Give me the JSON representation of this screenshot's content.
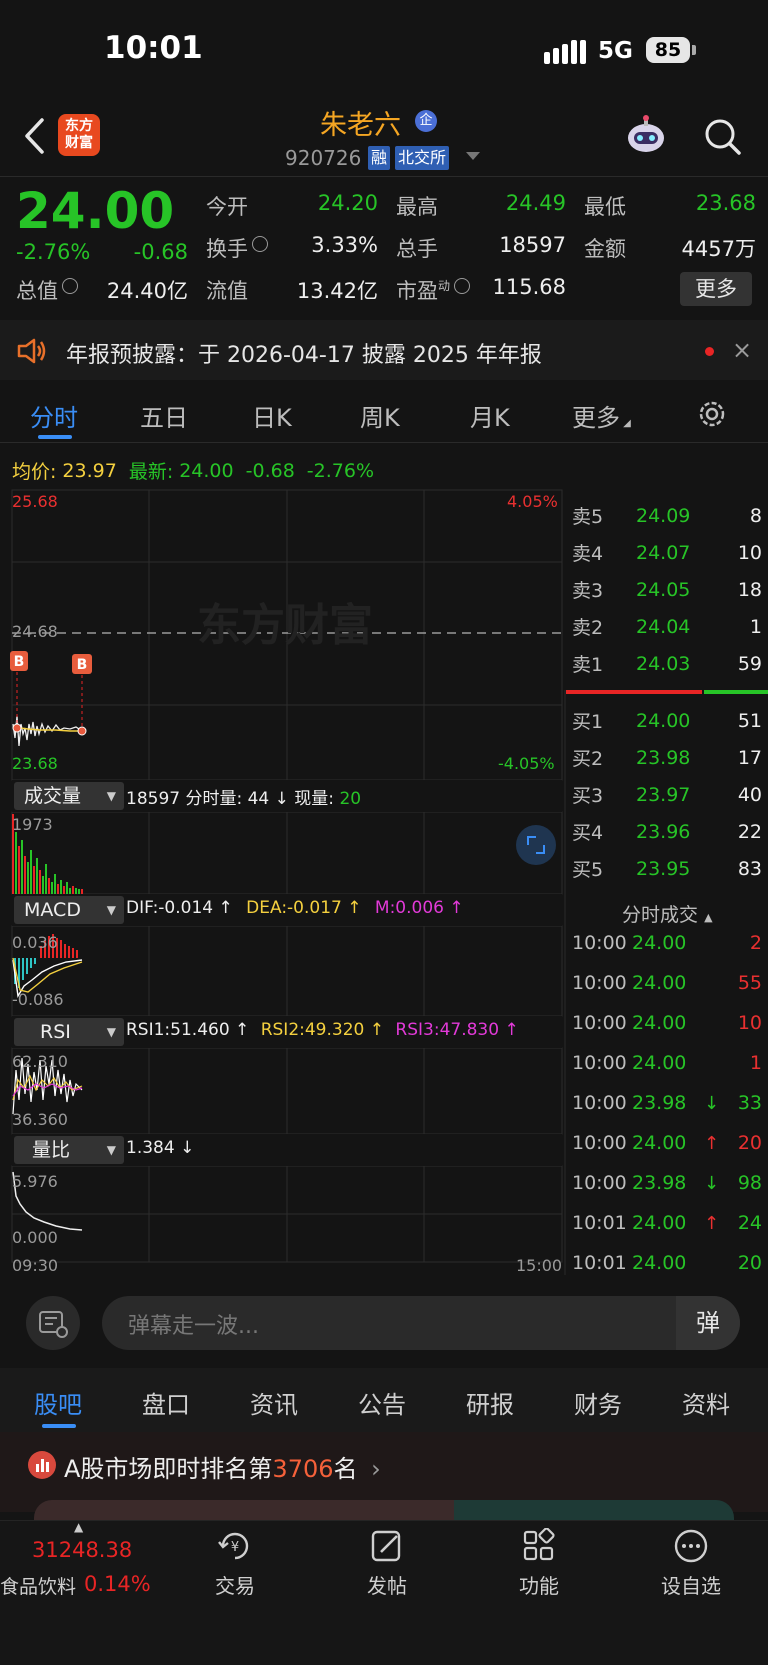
{
  "status": {
    "time": "10:01",
    "network": "5G",
    "battery": "85"
  },
  "header": {
    "logo_line1": "东方",
    "logo_line2": "财富",
    "stock_name": "朱老六",
    "enterprise_badge": "企",
    "stock_code": "920726",
    "tag_margin": "融",
    "tag_exchange": "北交所"
  },
  "quote": {
    "price": "24.00",
    "change_pct": "-2.76%",
    "change": "-0.68",
    "stats": [
      {
        "label": "今开",
        "value": "24.20",
        "color": "green"
      },
      {
        "label": "最高",
        "value": "24.49",
        "color": "green"
      },
      {
        "label": "最低",
        "value": "23.68",
        "color": "green"
      },
      {
        "label": "换手",
        "value": "3.33%",
        "color": "white"
      },
      {
        "label": "总手",
        "value": "18597",
        "color": "white"
      },
      {
        "label": "金额",
        "value": "4457万",
        "color": "white"
      },
      {
        "label": "总值",
        "value": "24.40亿",
        "color": "white"
      },
      {
        "label": "流值",
        "value": "13.42亿",
        "color": "white"
      },
      {
        "label": "市盈",
        "label_sup": "动",
        "value": "115.68",
        "color": "white"
      }
    ],
    "more_label": "更多"
  },
  "notice": {
    "text": "年报预披露：于 2026-04-17 披露 2025 年年报",
    "close": "×"
  },
  "chart_tabs": [
    "分时",
    "五日",
    "日K",
    "周K",
    "月K",
    "更多"
  ],
  "info_line": {
    "avg_label": "均价:",
    "avg_value": "23.97",
    "latest_label": "最新:",
    "latest_value": "24.00",
    "change": "-0.68",
    "pct": "-2.76%"
  },
  "price_axis": {
    "high": "25.68",
    "mid": "24.68",
    "low": "23.68",
    "high_pct": "4.05%",
    "low_pct": "-4.05%"
  },
  "watermark": "东方财富",
  "markers": [
    "B",
    "B"
  ],
  "volume_panel": {
    "selector": "成交量",
    "info": "18597 分时量: 44 ↓ 现量:",
    "now_volume": "20",
    "max": "1973"
  },
  "macd_panel": {
    "selector": "MACD",
    "dif": "DIF:-0.014 ↑",
    "dea": "DEA:-0.017 ↑",
    "m": "M:0.006 ↑",
    "max": "0.036",
    "min": "-0.086"
  },
  "rsi_panel": {
    "selector": "RSI",
    "rsi1": "RSI1:51.460 ↑",
    "rsi2": "RSI2:49.320 ↑",
    "rsi3": "RSI3:47.830 ↑",
    "max": "62.310",
    "min": "36.360"
  },
  "ratio_panel": {
    "selector": "量比",
    "info": "1.384 ↓",
    "max": "5.976",
    "min": "0.000"
  },
  "time_axis": {
    "start": "09:30",
    "end": "15:00"
  },
  "order_book": {
    "asks": [
      {
        "label": "卖5",
        "price": "24.09",
        "vol": "8"
      },
      {
        "label": "卖4",
        "price": "24.07",
        "vol": "10"
      },
      {
        "label": "卖3",
        "price": "24.05",
        "vol": "18"
      },
      {
        "label": "卖2",
        "price": "24.04",
        "vol": "1"
      },
      {
        "label": "卖1",
        "price": "24.03",
        "vol": "59"
      }
    ],
    "bids": [
      {
        "label": "买1",
        "price": "24.00",
        "vol": "51"
      },
      {
        "label": "买2",
        "price": "23.98",
        "vol": "17"
      },
      {
        "label": "买3",
        "price": "23.97",
        "vol": "40"
      },
      {
        "label": "买4",
        "price": "23.96",
        "vol": "22"
      },
      {
        "label": "买5",
        "price": "23.95",
        "vol": "83"
      }
    ]
  },
  "ticks": {
    "title": "分时成交",
    "rows": [
      {
        "time": "10:00",
        "price": "24.00",
        "arrow": "",
        "vol": "2",
        "side": "red"
      },
      {
        "time": "10:00",
        "price": "24.00",
        "arrow": "",
        "vol": "55",
        "side": "red"
      },
      {
        "time": "10:00",
        "price": "24.00",
        "arrow": "",
        "vol": "10",
        "side": "red"
      },
      {
        "time": "10:00",
        "price": "24.00",
        "arrow": "",
        "vol": "1",
        "side": "red"
      },
      {
        "time": "10:00",
        "price": "23.98",
        "arrow": "↓",
        "vol": "33",
        "side": "green"
      },
      {
        "time": "10:00",
        "price": "24.00",
        "arrow": "↑",
        "vol": "20",
        "side": "red"
      },
      {
        "time": "10:00",
        "price": "23.98",
        "arrow": "↓",
        "vol": "98",
        "side": "green"
      },
      {
        "time": "10:01",
        "price": "24.00",
        "arrow": "↑",
        "vol": "24",
        "side": "green"
      },
      {
        "time": "10:01",
        "price": "24.00",
        "arrow": "",
        "vol": "20",
        "side": "green"
      }
    ]
  },
  "danmu": {
    "placeholder": "弹幕走一波...",
    "send_label": "弹"
  },
  "bottom_tabs": [
    "股吧",
    "盘口",
    "资讯",
    "公告",
    "研报",
    "财务",
    "资料"
  ],
  "ranking": {
    "prefix": "A股市场即时排名第",
    "rank": "3706",
    "suffix": "名",
    "arrow": "›"
  },
  "index": {
    "value": "31248.38",
    "name": "食品饮料",
    "pct": "0.14%"
  },
  "nav": [
    "交易",
    "发帖",
    "功能",
    "设自选"
  ],
  "colors": {
    "up": "#e93030",
    "down": "#27c427",
    "accent": "#3a8ef6",
    "brand": "#e8491f",
    "name": "#f5a623"
  }
}
